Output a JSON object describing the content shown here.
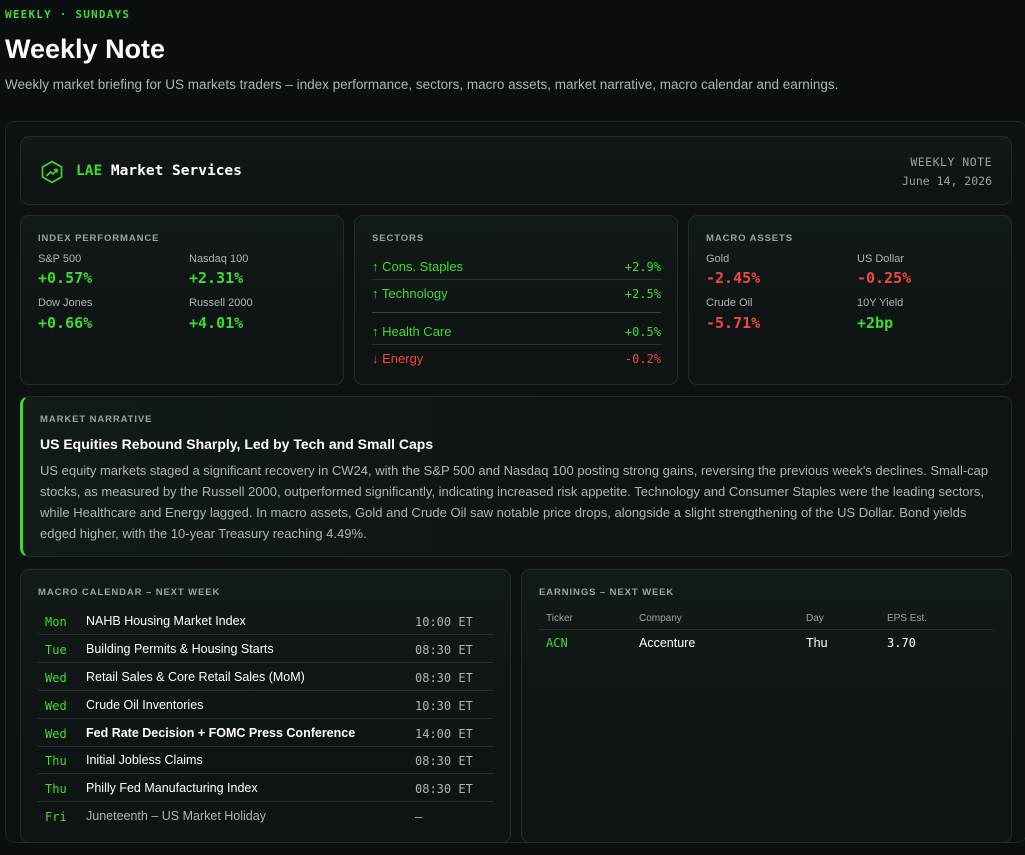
{
  "header": {
    "eyebrow": "WEEKLY · SUNDAYS",
    "title": "Weekly Note",
    "subtitle": "Weekly market briefing for US markets traders – index performance, sectors, macro assets, market narrative, macro calendar and earnings."
  },
  "brand": {
    "icon": "trending-up-hexagon-icon",
    "name_accent": "LAE",
    "name_rest": " Market Services",
    "meta_label": "WEEKLY NOTE",
    "meta_date": "June 14, 2026"
  },
  "colors": {
    "accent": "#3ddc2f",
    "negative": "#f2473f",
    "background": "#0b0e0f"
  },
  "index_performance": {
    "label": "INDEX PERFORMANCE",
    "items": [
      {
        "name": "S&P 500",
        "value": "+0.57%"
      },
      {
        "name": "Nasdaq 100",
        "value": "+2.31%"
      },
      {
        "name": "Dow Jones",
        "value": "+0.66%"
      },
      {
        "name": "Russell 2000",
        "value": "+4.01%"
      }
    ]
  },
  "sectors": {
    "label": "SECTORS",
    "items": [
      {
        "name": "↑ Cons. Staples",
        "value": "+2.9%",
        "direction": "up"
      },
      {
        "name": "↑ Technology",
        "value": "+2.5%",
        "direction": "up"
      },
      {
        "name": "↑ Health Care",
        "value": "+0.5%",
        "direction": "up"
      },
      {
        "name": "↓ Energy",
        "value": "-0.2%",
        "direction": "down"
      }
    ]
  },
  "macro_assets": {
    "label": "MACRO ASSETS",
    "items": [
      {
        "name": "Gold",
        "value": "-2.45%",
        "direction": "down"
      },
      {
        "name": "US Dollar",
        "value": "-0.25%",
        "direction": "down"
      },
      {
        "name": "Crude Oil",
        "value": "-5.71%",
        "direction": "down"
      },
      {
        "name": "10Y Yield",
        "value": "+2bp",
        "direction": "up"
      }
    ]
  },
  "narrative": {
    "label": "MARKET NARRATIVE",
    "title": "US Equities Rebound Sharply, Led by Tech and Small Caps",
    "body": "US equity markets staged a significant recovery in CW24, with the S&P 500 and Nasdaq 100 posting strong gains, reversing the previous week's declines. Small-cap stocks, as measured by the Russell 2000, outperformed significantly, indicating increased risk appetite. Technology and Consumer Staples were the leading sectors, while Healthcare and Energy lagged. In macro assets, Gold and Crude Oil saw notable price drops, alongside a slight strengthening of the US Dollar. Bond yields edged higher, with the 10-year Treasury reaching 4.49%."
  },
  "calendar": {
    "label": "MACRO CALENDAR – NEXT WEEK",
    "rows": [
      {
        "day": "Mon",
        "event": "NAHB Housing Market Index",
        "time": "10:00 ET"
      },
      {
        "day": "Tue",
        "event": "Building Permits & Housing Starts",
        "time": "08:30 ET"
      },
      {
        "day": "Wed",
        "event": "Retail Sales & Core Retail Sales (MoM)",
        "time": "08:30 ET"
      },
      {
        "day": "Wed",
        "event": "Crude Oil Inventories",
        "time": "10:30 ET"
      },
      {
        "day": "Wed",
        "event": "Fed Rate Decision + FOMC Press Conference",
        "time": "14:00 ET"
      },
      {
        "day": "Thu",
        "event": "Initial Jobless Claims",
        "time": "08:30 ET"
      },
      {
        "day": "Thu",
        "event": "Philly Fed Manufacturing Index",
        "time": "08:30 ET"
      },
      {
        "day": "Fri",
        "event": "Juneteenth – US Market Holiday",
        "time": "–"
      }
    ]
  },
  "earnings": {
    "label": "EARNINGS – NEXT WEEK",
    "columns": [
      "Ticker",
      "Company",
      "Day",
      "EPS Est."
    ],
    "rows": [
      {
        "ticker": "ACN",
        "company": "Accenture",
        "day": "Thu",
        "eps": "3.70"
      }
    ]
  }
}
